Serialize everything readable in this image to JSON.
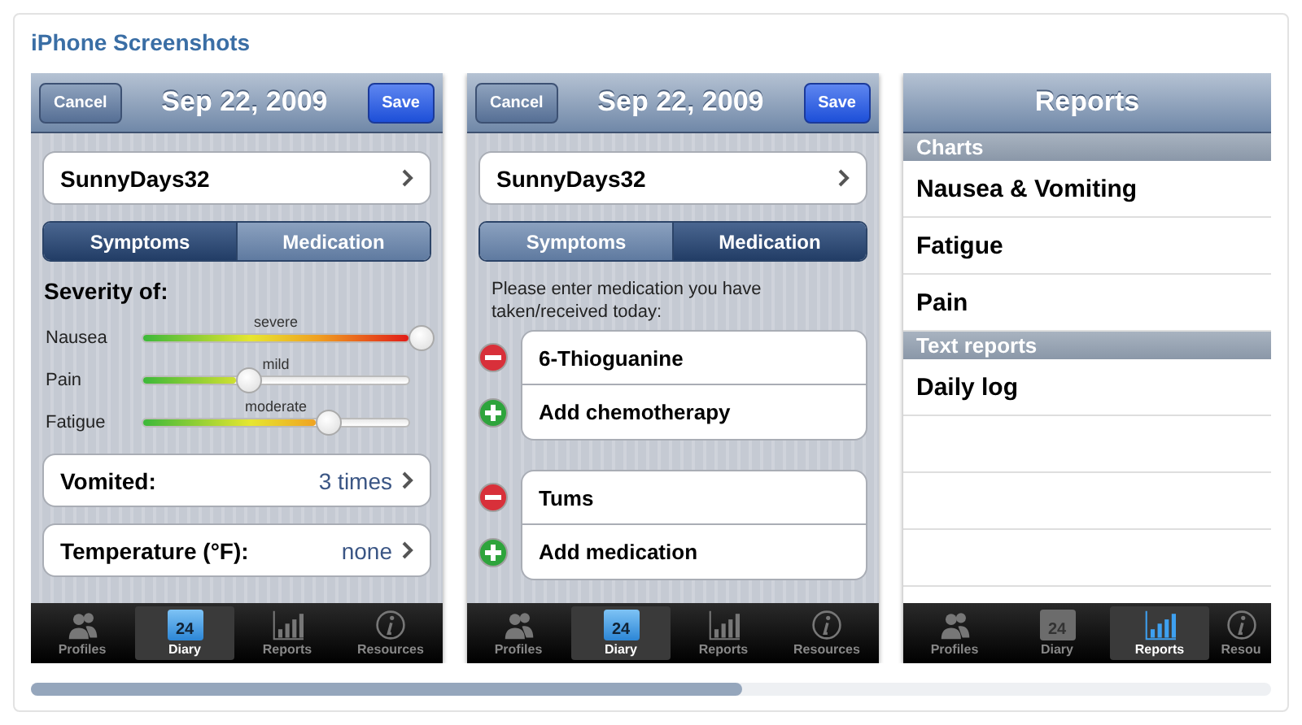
{
  "section_title": "iPhone Screenshots",
  "screens": [
    {
      "kind": "symptoms",
      "nav": {
        "cancel": "Cancel",
        "title": "Sep 22, 2009",
        "save": "Save"
      },
      "profile": "SunnyDays32",
      "segments": [
        {
          "label": "Symptoms",
          "selected": true
        },
        {
          "label": "Medication",
          "selected": false
        }
      ],
      "severity_heading": "Severity of:",
      "sliders": [
        {
          "name": "Nausea",
          "caption": "severe",
          "level": 1.0
        },
        {
          "name": "Pain",
          "caption": "mild",
          "level": 0.35
        },
        {
          "name": "Fatigue",
          "caption": "moderate",
          "level": 0.65
        }
      ],
      "rows": [
        {
          "label": "Vomited:",
          "value": "3 times"
        },
        {
          "label": "Temperature (°F):",
          "value": "none"
        }
      ],
      "tabs": [
        {
          "kind": "people",
          "label": "Profiles",
          "selected": false
        },
        {
          "kind": "calendar",
          "icon_text": "24",
          "label": "Diary",
          "selected": true
        },
        {
          "kind": "bars",
          "label": "Reports",
          "selected": false
        },
        {
          "kind": "info",
          "label": "Resources",
          "selected": false
        }
      ]
    },
    {
      "kind": "medication",
      "nav": {
        "cancel": "Cancel",
        "title": "Sep 22, 2009",
        "save": "Save"
      },
      "profile": "SunnyDays32",
      "segments": [
        {
          "label": "Symptoms",
          "selected": false
        },
        {
          "label": "Medication",
          "selected": true
        }
      ],
      "instruction": "Please enter medication you have taken/received today:",
      "groups": [
        {
          "items": [
            {
              "kind": "remove",
              "label": "6-Thioguanine"
            },
            {
              "kind": "add",
              "label": "Add chemotherapy"
            }
          ]
        },
        {
          "items": [
            {
              "kind": "remove",
              "label": "Tums"
            },
            {
              "kind": "add",
              "label": "Add medication"
            }
          ]
        }
      ],
      "tabs": [
        {
          "kind": "people",
          "label": "Profiles",
          "selected": false
        },
        {
          "kind": "calendar",
          "icon_text": "24",
          "label": "Diary",
          "selected": true
        },
        {
          "kind": "bars",
          "label": "Reports",
          "selected": false
        },
        {
          "kind": "info",
          "label": "Resources",
          "selected": false
        }
      ]
    },
    {
      "kind": "reports",
      "nav": {
        "title": "Reports"
      },
      "sections": [
        {
          "header": "Charts",
          "items": [
            "Nausea & Vomiting",
            "Fatigue",
            "Pain"
          ]
        },
        {
          "header": "Text reports",
          "items": [
            "Daily log"
          ]
        }
      ],
      "tabs": [
        {
          "kind": "people",
          "label": "Profiles",
          "selected": false
        },
        {
          "kind": "calendar",
          "icon_text": "24",
          "label": "Diary",
          "selected": false
        },
        {
          "kind": "bars",
          "label": "Reports",
          "selected": true
        },
        {
          "kind": "info",
          "label": "Resou",
          "selected": false
        }
      ]
    }
  ]
}
